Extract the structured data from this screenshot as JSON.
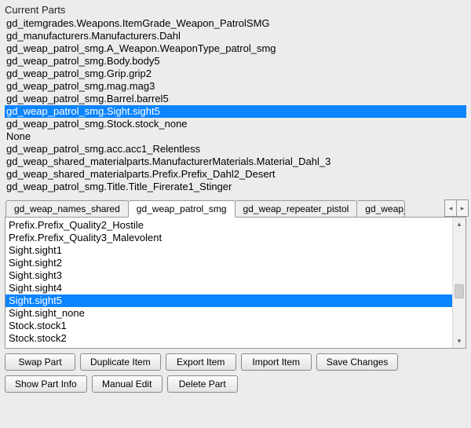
{
  "section_title": "Current Parts",
  "current_parts": [
    "gd_itemgrades.Weapons.ItemGrade_Weapon_PatrolSMG",
    "gd_manufacturers.Manufacturers.Dahl",
    "gd_weap_patrol_smg.A_Weapon.WeaponType_patrol_smg",
    "gd_weap_patrol_smg.Body.body5",
    "gd_weap_patrol_smg.Grip.grip2",
    "gd_weap_patrol_smg.mag.mag3",
    "gd_weap_patrol_smg.Barrel.barrel5",
    "gd_weap_patrol_smg.Sight.sight5",
    "gd_weap_patrol_smg.Stock.stock_none",
    "None",
    "gd_weap_patrol_smg.acc.acc1_Relentless",
    "gd_weap_shared_materialparts.ManufacturerMaterials.Material_Dahl_3",
    "gd_weap_shared_materialparts.Prefix.Prefix_Dahl2_Desert",
    "gd_weap_patrol_smg.Title.Title_Firerate1_Stinger"
  ],
  "current_parts_selected_index": 7,
  "tabs": [
    "gd_weap_names_shared",
    "gd_weap_patrol_smg",
    "gd_weap_repeater_pistol",
    "gd_weap_"
  ],
  "tabs_active_index": 1,
  "sub_parts": [
    "Prefix.Prefix_Quality2_Hostile",
    "Prefix.Prefix_Quality3_Malevolent",
    "Sight.sight1",
    "Sight.sight2",
    "Sight.sight3",
    "Sight.sight4",
    "Sight.sight5",
    "Sight.sight_none",
    "Stock.stock1",
    "Stock.stock2"
  ],
  "sub_parts_selected_index": 6,
  "buttons_row1": [
    "Swap Part",
    "Duplicate Item",
    "Export Item",
    "Import Item",
    "Save Changes"
  ],
  "buttons_row2": [
    "Show Part Info",
    "Manual Edit",
    "Delete Part"
  ],
  "nav_left": "◂",
  "nav_right": "▸",
  "scroll_up": "▴",
  "scroll_down": "▾"
}
